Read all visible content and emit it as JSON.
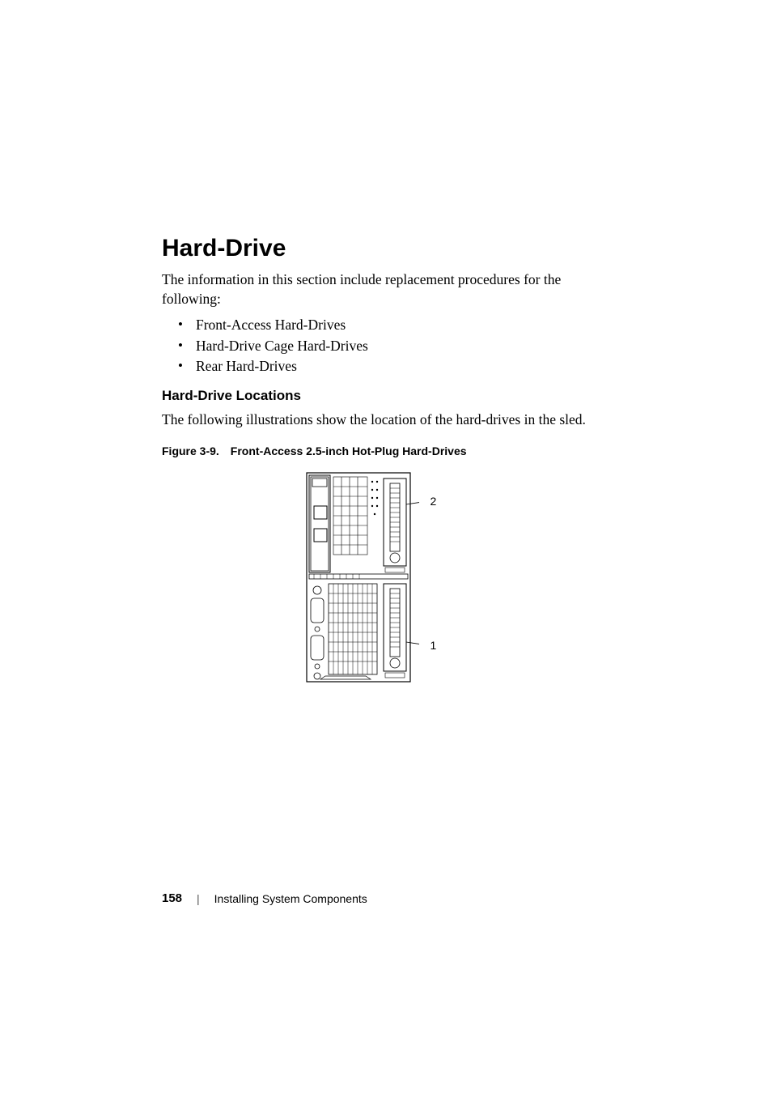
{
  "heading": "Hard-Drive",
  "intro": "The information in this section include replacement procedures for the following:",
  "bullets": [
    "Front-Access Hard-Drives",
    "Hard-Drive Cage Hard-Drives",
    "Rear Hard-Drives"
  ],
  "subheading": "Hard-Drive Locations",
  "body": "The following illustrations show the location of the hard-drives in the sled.",
  "figure": {
    "label_prefix": "Figure 3-9.",
    "title": "Front-Access 2.5-inch Hot-Plug Hard-Drives",
    "callouts": {
      "top": "2",
      "bottom": "1"
    }
  },
  "footer": {
    "page_number": "158",
    "separator": "|",
    "section_title": "Installing System Components"
  }
}
